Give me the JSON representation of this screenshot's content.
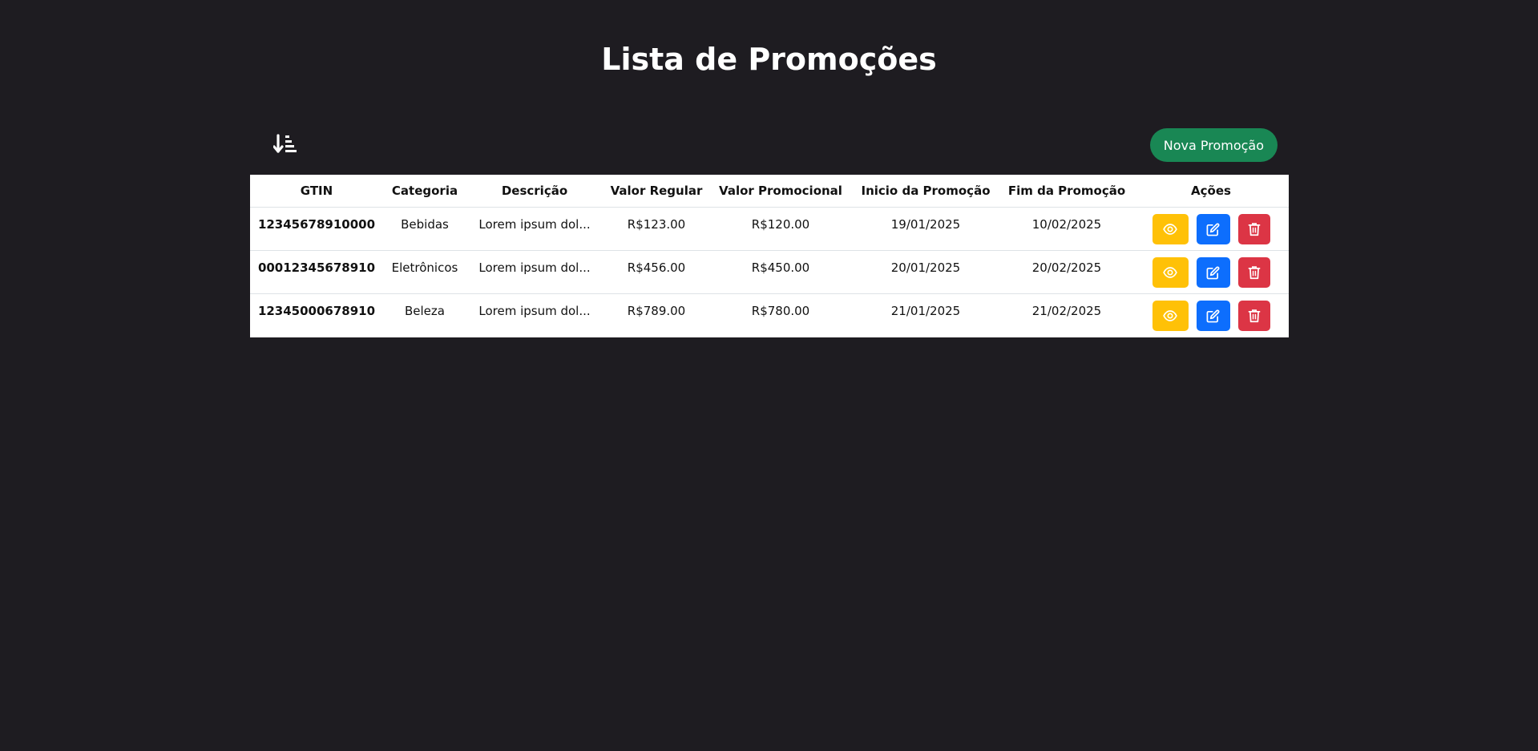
{
  "page": {
    "title": "Lista de Promoções"
  },
  "toolbar": {
    "sort_icon": "sort-amount-down-icon",
    "new_label": "Nova Promoção"
  },
  "table": {
    "headers": {
      "gtin": "GTIN",
      "categoria": "Categoria",
      "descricao": "Descrição",
      "valor_regular": "Valor Regular",
      "valor_promocional": "Valor Promocional",
      "inicio": "Inicio da Promoção",
      "fim": "Fim da Promoção",
      "acoes": "Ações"
    },
    "rows": [
      {
        "gtin": "12345678910000",
        "categoria": "Bebidas",
        "descricao": "Lorem ipsum dol...",
        "valor_regular": "R$123.00",
        "valor_promocional": "R$120.00",
        "inicio": "19/01/2025",
        "fim": "10/02/2025"
      },
      {
        "gtin": "00012345678910",
        "categoria": "Eletrônicos",
        "descricao": "Lorem ipsum dol...",
        "valor_regular": "R$456.00",
        "valor_promocional": "R$450.00",
        "inicio": "20/01/2025",
        "fim": "20/02/2025"
      },
      {
        "gtin": "12345000678910",
        "categoria": "Beleza",
        "descricao": "Lorem ipsum dol...",
        "valor_regular": "R$789.00",
        "valor_promocional": "R$780.00",
        "inicio": "21/01/2025",
        "fim": "21/02/2025"
      }
    ],
    "action_icons": {
      "view": "eye-icon",
      "edit": "edit-icon",
      "delete": "trash-icon"
    }
  },
  "colors": {
    "background": "#1e1c21",
    "new_button": "#198754",
    "view_button": "#ffc107",
    "edit_button": "#0d6efd",
    "delete_button": "#dc3545"
  }
}
